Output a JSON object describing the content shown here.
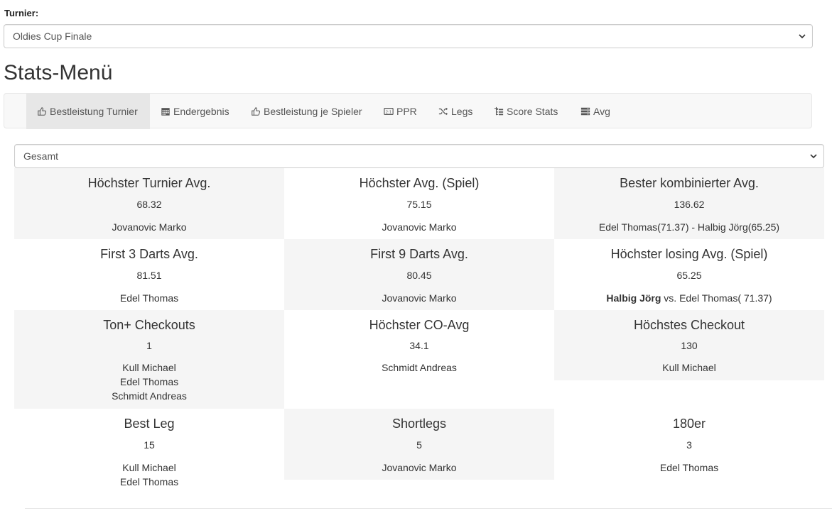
{
  "turnier": {
    "label": "Turnier:",
    "selected": "Oldies Cup Finale"
  },
  "stats_menu": {
    "title": "Stats-Menü"
  },
  "nav": {
    "items": [
      {
        "label": "Bestleistung Turnier",
        "icon": "thumbs-up-icon"
      },
      {
        "label": "Endergebnis",
        "icon": "calendar-icon"
      },
      {
        "label": "Bestleistung je Spieler",
        "icon": "thumbs-up-icon"
      },
      {
        "label": "PPR",
        "icon": "scoreboard-icon"
      },
      {
        "label": "Legs",
        "icon": "shuffle-icon"
      },
      {
        "label": "Score Stats",
        "icon": "tree-list-icon"
      },
      {
        "label": "Avg",
        "icon": "server-icon"
      }
    ]
  },
  "filter": {
    "selected": "Gesamt"
  },
  "stats": [
    {
      "title": "Höchster Turnier Avg.",
      "value": "68.32",
      "names": [
        "Jovanovic Marko"
      ]
    },
    {
      "title": "Höchster Avg. (Spiel)",
      "value": "75.15",
      "names": [
        "Jovanovic Marko"
      ]
    },
    {
      "title": "Bester kombinierter Avg.",
      "value": "136.62",
      "names": [
        "Edel Thomas(71.37) - Halbig Jörg(65.25)"
      ]
    },
    {
      "title": "First 3 Darts Avg.",
      "value": "81.51",
      "names": [
        "Edel Thomas"
      ]
    },
    {
      "title": "First 9 Darts Avg.",
      "value": "80.45",
      "names": [
        "Jovanovic Marko"
      ]
    },
    {
      "title": "Höchster losing Avg. (Spiel)",
      "value": "65.25",
      "loser": "Halbig Jörg",
      "vs": " vs. Edel Thomas( 71.37)"
    },
    {
      "title": "Ton+ Checkouts",
      "value": "1",
      "names": [
        "Kull Michael",
        "Edel Thomas",
        "Schmidt Andreas"
      ]
    },
    {
      "title": "Höchster CO-Avg",
      "value": "34.1",
      "names": [
        "Schmidt Andreas"
      ]
    },
    {
      "title": "Höchstes Checkout",
      "value": "130",
      "names": [
        "Kull Michael"
      ]
    },
    {
      "title": "Best Leg",
      "value": "15",
      "names": [
        "Kull Michael",
        "Edel Thomas"
      ]
    },
    {
      "title": "Shortlegs",
      "value": "5",
      "names": [
        "Jovanovic Marko"
      ]
    },
    {
      "title": "180er",
      "value": "3",
      "names": [
        "Edel Thomas"
      ]
    }
  ]
}
